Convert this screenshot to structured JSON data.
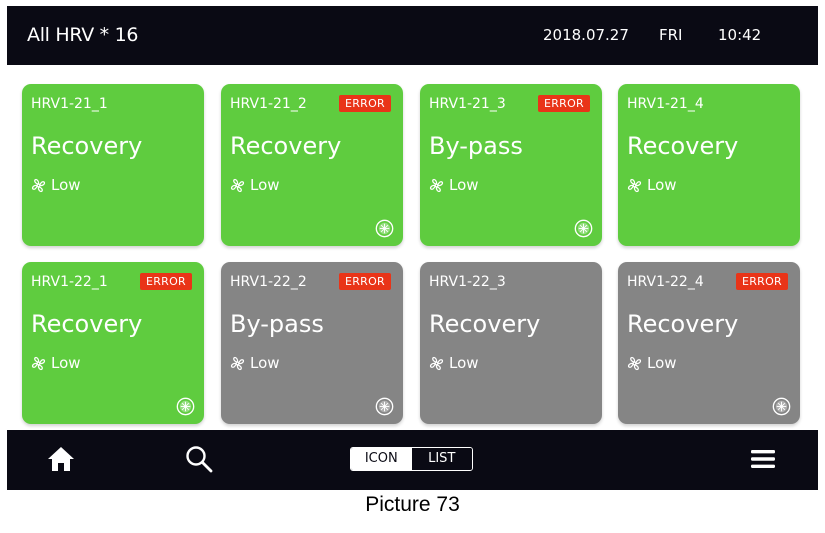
{
  "header": {
    "title": "All HRV * 16",
    "date": "2018.07.27",
    "day": "FRI",
    "time": "10:42"
  },
  "tiles": [
    {
      "name": "HRV1-21_1",
      "mode": "Recovery",
      "fan": "Low",
      "error": "",
      "status": "on",
      "filter": false
    },
    {
      "name": "HRV1-21_2",
      "mode": "Recovery",
      "fan": "Low",
      "error": "ERROR",
      "status": "on",
      "filter": true
    },
    {
      "name": "HRV1-21_3",
      "mode": "By-pass",
      "fan": "Low",
      "error": "ERROR",
      "status": "on",
      "filter": true
    },
    {
      "name": "HRV1-21_4",
      "mode": "Recovery",
      "fan": "Low",
      "error": "",
      "status": "on",
      "filter": false
    },
    {
      "name": "HRV1-22_1",
      "mode": "Recovery",
      "fan": "Low",
      "error": "ERROR",
      "status": "on",
      "filter": true
    },
    {
      "name": "HRV1-22_2",
      "mode": "By-pass",
      "fan": "Low",
      "error": "ERROR",
      "status": "off",
      "filter": true
    },
    {
      "name": "HRV1-22_3",
      "mode": "Recovery",
      "fan": "Low",
      "error": "",
      "status": "off",
      "filter": false
    },
    {
      "name": "HRV1-22_4",
      "mode": "Recovery",
      "fan": "Low",
      "error": "ERROR",
      "status": "off",
      "filter": true
    }
  ],
  "footer": {
    "view_icon_label": "ICON",
    "view_list_label": "LIST",
    "active_view": "ICON"
  },
  "icons": {
    "home": "home-icon",
    "search": "search-icon",
    "menu": "menu-icon",
    "fan": "fan-icon",
    "filter": "filter-icon"
  },
  "colors": {
    "bar": "#0a0a14",
    "tile_on": "#5fcc3f",
    "tile_off": "#858585",
    "error": "#e93418"
  },
  "caption": "Picture 73"
}
